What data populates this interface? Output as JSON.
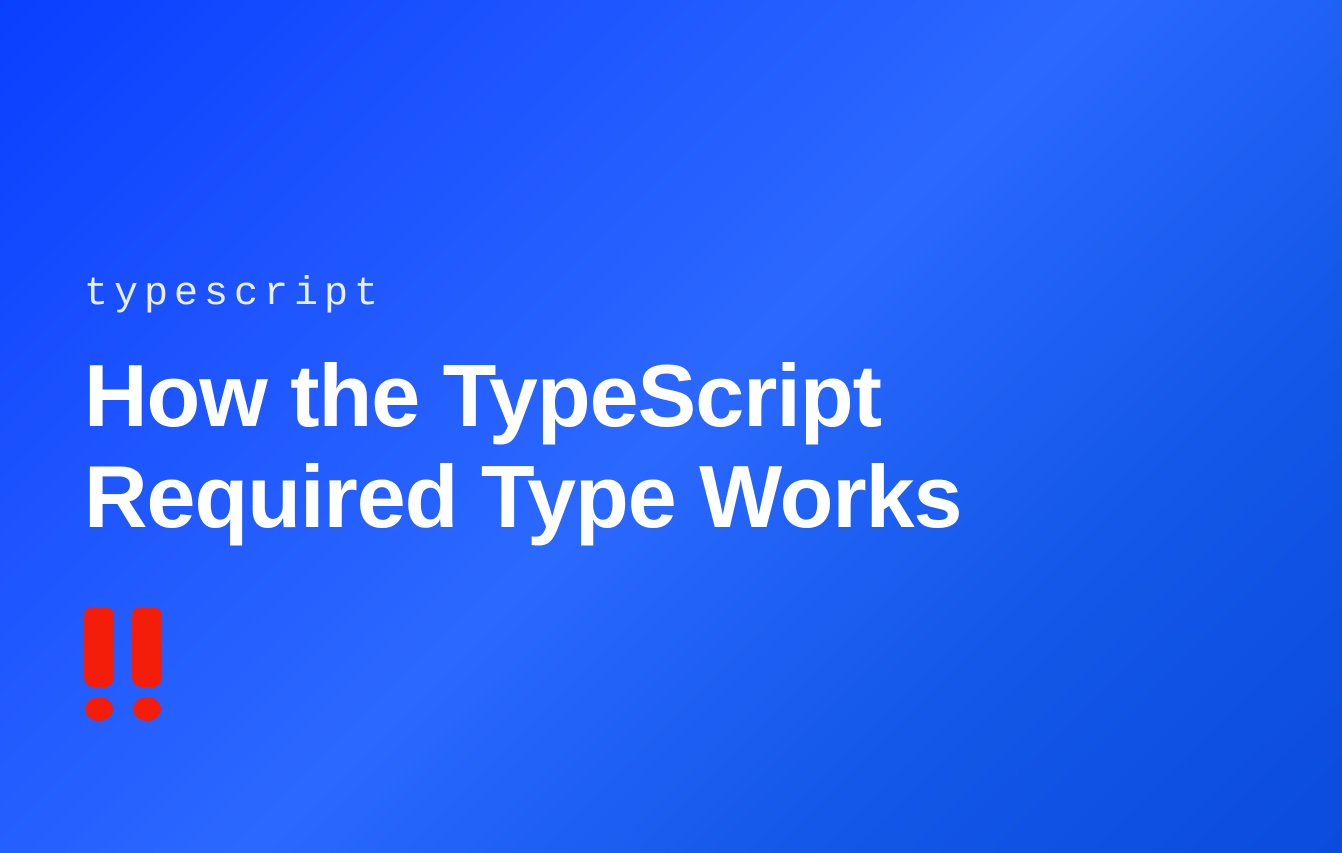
{
  "category": "typescript",
  "title": "How the TypeScript Required Type Works",
  "accent_color": "#F31D0A",
  "background_gradient": {
    "from": "#0A3FFF",
    "to": "#0B4BDE"
  }
}
